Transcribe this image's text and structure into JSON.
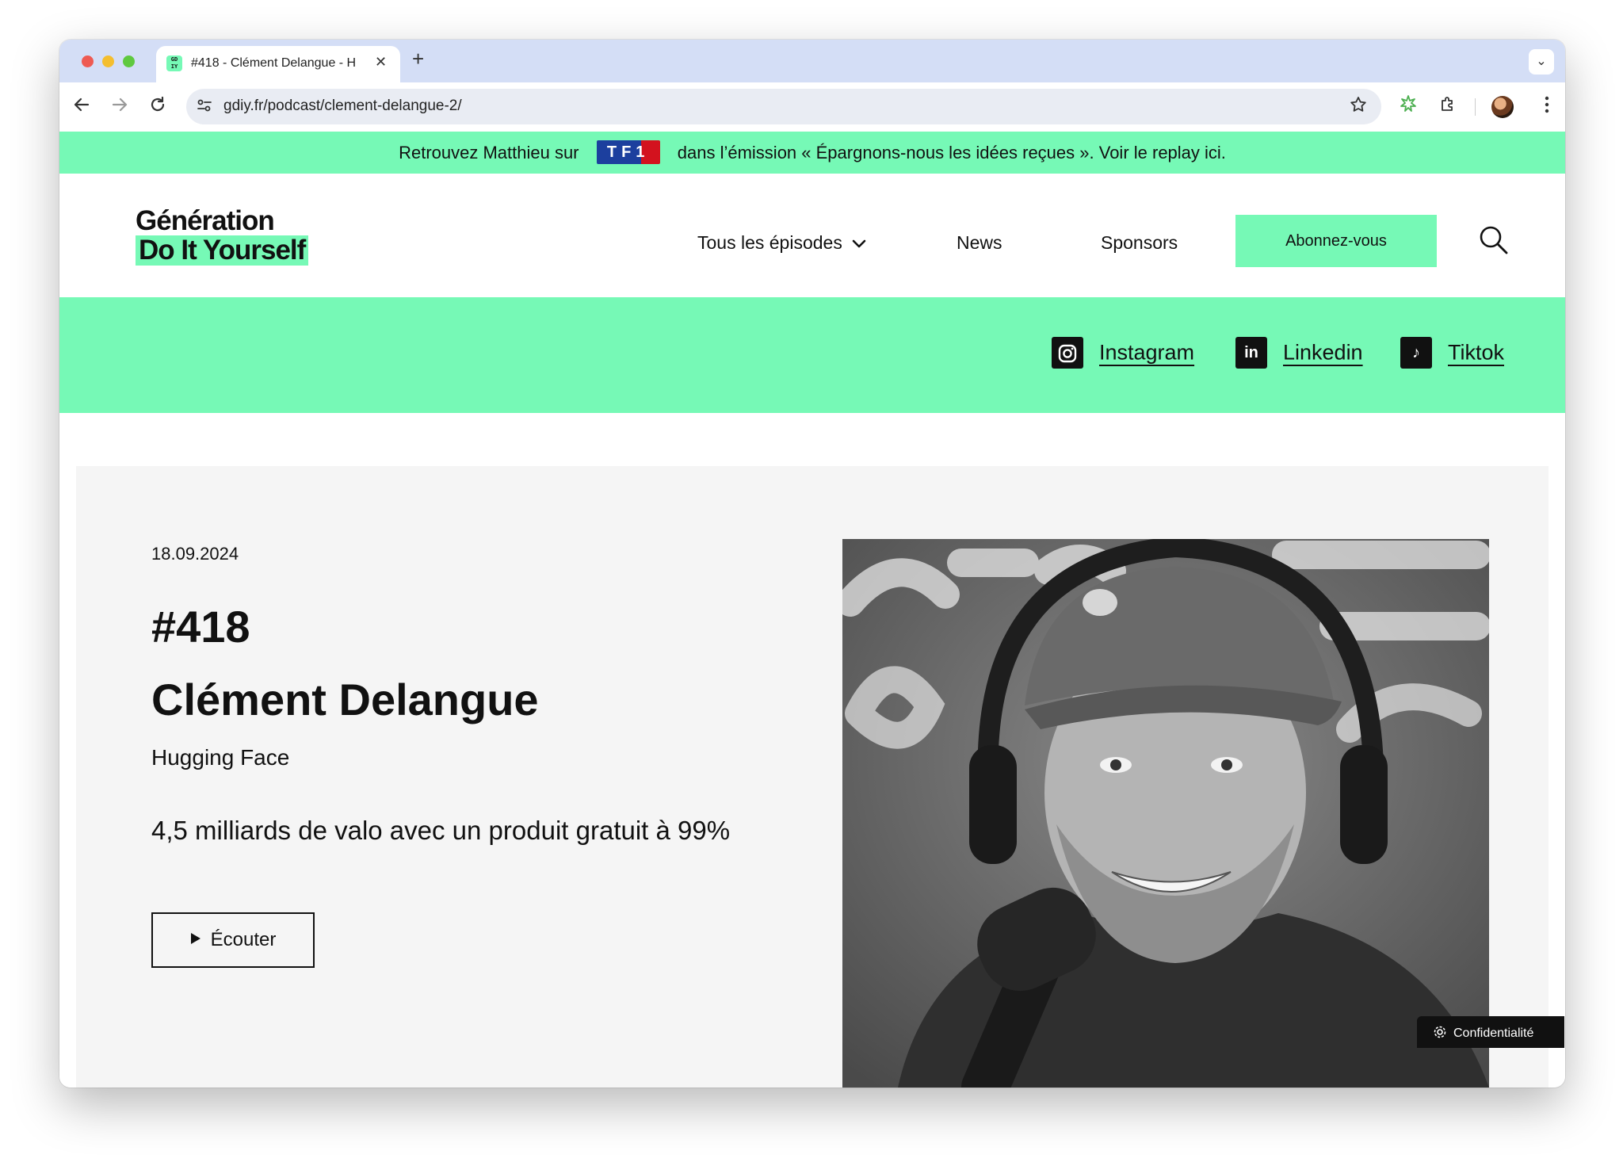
{
  "browser": {
    "tab_title": "#418 - Clément Delangue - H",
    "favicon_text": "GD IY",
    "close_glyph": "✕",
    "new_tab_glyph": "+",
    "tab_menu_glyph": "⌄",
    "url": "gdiy.fr/podcast/clement-delangue-2/"
  },
  "promo": {
    "before": "Retrouvez Matthieu sur",
    "logo_text": "TF1",
    "after": "dans l’émission « Épargnons-nous les idées reçues ». Voir le replay ici."
  },
  "header": {
    "logo_line1": "Génération",
    "logo_line2": "Do It Yourself",
    "nav": {
      "episodes": "Tous les épisodes",
      "news": "News",
      "sponsors": "Sponsors"
    },
    "subscribe": "Abonnez-vous"
  },
  "social": {
    "instagram": "Instagram",
    "linkedin": "Linkedin",
    "tiktok": "Tiktok",
    "linkedin_glyph": "in",
    "tiktok_glyph": "♪"
  },
  "episode": {
    "date": "18.09.2024",
    "number": "#418",
    "guest": "Clément Delangue",
    "company": "Hugging Face",
    "tagline": "4,5 milliards de valo avec un produit gratuit à 99%",
    "listen_label": "Écouter"
  },
  "cookie": {
    "label": "Confidentialité"
  },
  "icons": {
    "back": "arrow-left-icon",
    "forward": "arrow-right-icon",
    "reload": "reload-icon",
    "star": "star-icon",
    "search": "search-icon",
    "play": "play-icon",
    "gear": "gear-icon"
  },
  "colors": {
    "brand_green": "#76f9b6",
    "tab_strip": "#d4def6",
    "hero_bg": "#f5f5f5"
  }
}
